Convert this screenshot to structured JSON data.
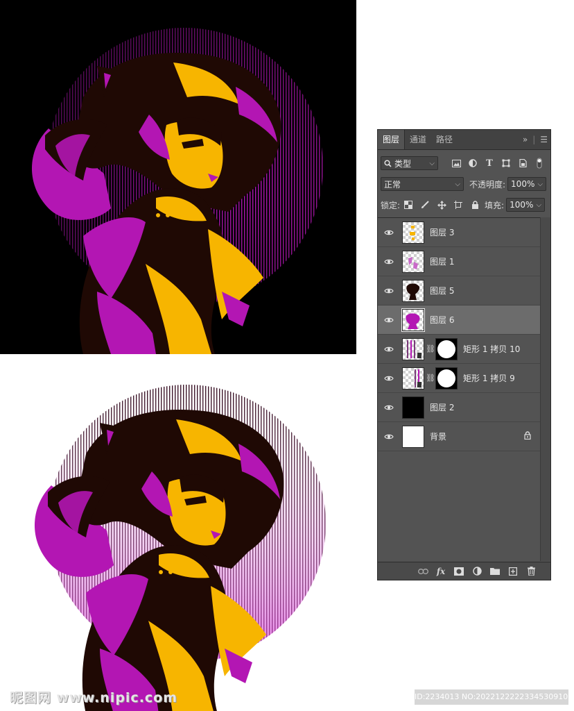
{
  "colors": {
    "magenta": "#b316b3",
    "yellow": "#f7b500",
    "dark_brown": "#1f0904",
    "panel_bg": "#535353"
  },
  "panel": {
    "tabs": [
      "图层",
      "通道",
      "路径"
    ],
    "active_tab": "图层",
    "menu_icons": [
      "double-chevron-right-icon",
      "menu-icon"
    ],
    "filter": {
      "kind_label": "类型",
      "icons": [
        "image-filter-icon",
        "adjustment-filter-icon",
        "type-filter-icon",
        "shape-filter-icon",
        "smart-object-filter-icon",
        "filter-toggle-icon"
      ]
    },
    "blend": {
      "mode": "正常",
      "opacity_label": "不透明度:",
      "opacity_value": "100%"
    },
    "lock": {
      "label": "锁定:",
      "icons": [
        "lock-transparent-icon",
        "lock-image-icon",
        "lock-position-icon",
        "lock-artboard-icon",
        "lock-all-icon"
      ],
      "fill_label": "填充:",
      "fill_value": "100%"
    },
    "layers": [
      {
        "name": "图层 3",
        "thumb": "checker-yellow",
        "selected": false
      },
      {
        "name": "图层 1",
        "thumb": "checker-magenta",
        "selected": false
      },
      {
        "name": "图层 5",
        "thumb": "checker-figure",
        "selected": false
      },
      {
        "name": "图层 6",
        "thumb": "checker-magenta-figure",
        "selected": true
      },
      {
        "name": "矩形 1 拷贝 10",
        "thumb": "checker-stripes",
        "mask": true,
        "selected": false
      },
      {
        "name": "矩形 1 拷贝 9",
        "thumb": "checker-stripes",
        "mask": true,
        "selected": false
      },
      {
        "name": "图层 2",
        "thumb": "black",
        "selected": false
      },
      {
        "name": "背景",
        "thumb": "white",
        "locked": true,
        "selected": false
      }
    ],
    "footer_icons": [
      "link-layers-icon",
      "fx-icon",
      "add-mask-icon",
      "adjustment-layer-icon",
      "folder-icon",
      "new-layer-icon",
      "trash-icon"
    ]
  },
  "watermark": {
    "left": "昵图网 www.nipic.com",
    "right": "ID:2234013 NO:20221222223345309100"
  }
}
